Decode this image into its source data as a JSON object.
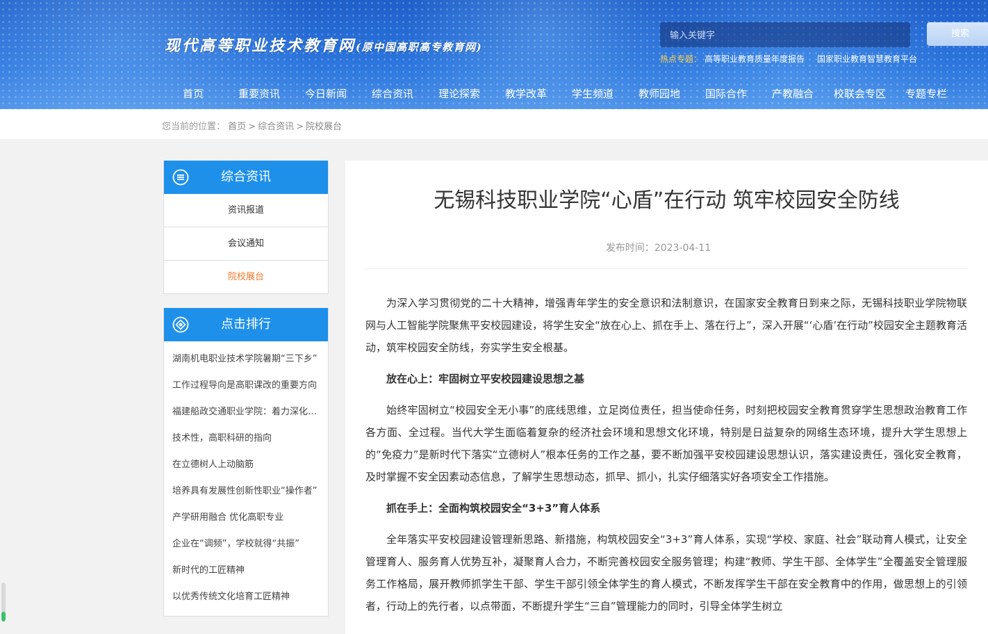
{
  "header": {
    "site_title": "现代高等职业技术教育网",
    "site_subtitle": "(原中国高职高专教育网)",
    "search_placeholder": "输入关键字",
    "search_button": "搜索",
    "hot_label": "热点专题：",
    "hot_links": [
      "高等职业教育质量年度报告",
      "国家职业教育智慧教育平台"
    ]
  },
  "nav": [
    "首页",
    "重要资讯",
    "今日新闻",
    "综合资讯",
    "理论探索",
    "教学改革",
    "学生频道",
    "教师园地",
    "国际合作",
    "产教融合",
    "校联会专区",
    "专题专栏"
  ],
  "breadcrumb": {
    "prefix": "您当前的位置：",
    "items": [
      "首页",
      "综合资讯",
      "院校展台"
    ],
    "separator": ">"
  },
  "sidebar": {
    "category": {
      "title": "综合资讯",
      "items": [
        "资讯报道",
        "会议通知",
        "院校展台"
      ],
      "active_index": 2
    },
    "ranking": {
      "title": "点击排行",
      "items": [
        "湖南机电职业技术学院暑期“三下乡”",
        "工作过程导向是高职课改的重要方向",
        "福建船政交通职业学院：着力深化改革",
        "技术性，高职科研的指向",
        "在立德树人上动脑筋",
        "培养具有发展性创新性职业“操作者”",
        "产学研用融合 优化高职专业",
        "企业在“调频”，学校就得“共振”",
        "新时代的工匠精神",
        "以优秀传统文化培育工匠精神"
      ]
    }
  },
  "article": {
    "title": "无锡科技职业学院“心盾”在行动 筑牢校园安全防线",
    "meta_label": "发布时间：",
    "date": "2023-04-11",
    "paragraphs": [
      "为深入学习贯彻党的二十大精神，增强青年学生的安全意识和法制意识，在国家安全教育日到来之际，无锡科技职业学院物联网与人工智能学院聚焦平安校园建设，将学生安全“放在心上、抓在手上、落在行上”，深入开展“‘心盾’在行动”校园安全主题教育活动，筑牢校园安全防线，夯实学生安全根基。",
      "放在心上：牢固树立平安校园建设思想之基",
      "始终牢固树立“校园安全无小事”的底线思维，立足岗位责任，担当使命任务，时刻把校园安全教育贯穿学生思想政治教育工作各方面、全过程。当代大学生面临着复杂的经济社会环境和思想文化环境，特别是日益复杂的网络生态环境，提升大学生思想上的“免疫力”是新时代下落实“立德树人”根本任务的工作之基，要不断加强平安校园建设思想认识，落实建设责任，强化安全教育，及时掌握不安全因素动态信息，了解学生思想动态，抓早、抓小，扎实仔细落实好各项安全工作措施。",
      "抓在手上：全面构筑校园安全“3+3”育人体系",
      "全年落实平安校园建设管理新思路、新措施，构筑校园安全“3+3”育人体系，实现“学校、家庭、社会”联动育人模式，让安全管理育人、服务育人优势互补，凝聚育人合力，不断完善校园安全服务管理；构建“教师、学生干部、全体学生”全覆盖安全管理服务工作格局，展开教师抓学生干部、学生干部引领全体学生的育人模式，不断发挥学生干部在安全教育中的作用，做思想上的引领者，行动上的先行者，以点带面，不断提升学生“三自”管理能力的同时，引导全体学生树立"
    ],
    "heading_indices": [
      1,
      3
    ]
  },
  "colors": {
    "accent": "#1e90ea",
    "active_link": "#f0772b",
    "hot_label": "#ffd24d"
  }
}
